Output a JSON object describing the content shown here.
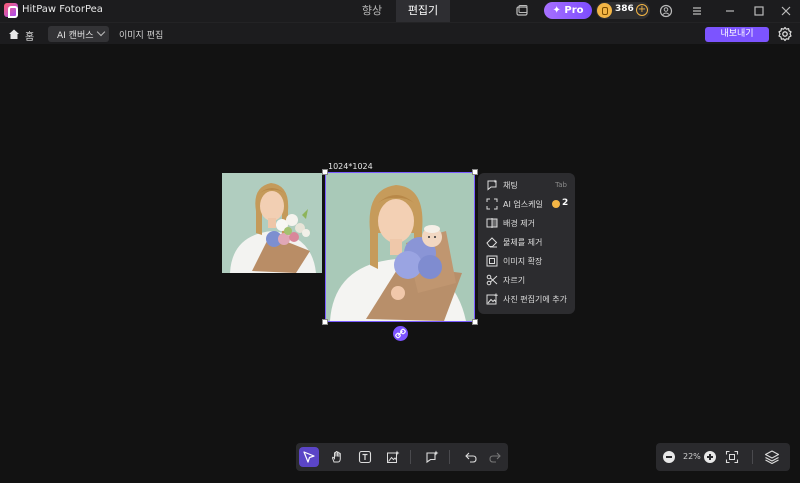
{
  "app": {
    "title": "HitPaw FotorPea",
    "tabs": [
      {
        "label": "향상",
        "active": false
      },
      {
        "label": "편집기",
        "active": true
      }
    ],
    "pro_label": "✦ Pro",
    "coins": "386",
    "window_icons": [
      "screen-icon",
      "account-icon",
      "menu-icon",
      "minimize-icon",
      "maximize-icon",
      "close-icon"
    ]
  },
  "subbar": {
    "home_label": "홈",
    "canvas_select": "AI 캔버스",
    "image_edit_label": "이미지 편집",
    "export_label": "내보내기"
  },
  "canvas": {
    "dimension_label": "1024*1024",
    "selection_color": "#7a5cff"
  },
  "context_menu": {
    "items": [
      {
        "label": "채팅",
        "shortcut": "Tab",
        "icon": "chat-icon"
      },
      {
        "label": "AI 업스케일",
        "badge": "2",
        "icon": "upscale-icon"
      },
      {
        "label": "배경 제거",
        "icon": "background-remove-icon"
      },
      {
        "label": "물체를 제거",
        "icon": "eraser-icon"
      },
      {
        "label": "이미지 확장",
        "icon": "expand-icon"
      },
      {
        "label": "자르기",
        "icon": "scissors-icon"
      },
      {
        "label": "사진 편집기에 추가",
        "icon": "add-image-icon"
      }
    ]
  },
  "bottom_toolbar": {
    "tools": [
      "select-icon",
      "hand-icon",
      "text-icon",
      "image-ai-icon",
      "chat-add-icon",
      "undo-icon",
      "redo-icon"
    ],
    "active": "select-icon"
  },
  "zoom": {
    "value": "22%"
  },
  "colors": {
    "accent": "#7c54ff",
    "coin": "#f3b545",
    "background": "#121212"
  }
}
